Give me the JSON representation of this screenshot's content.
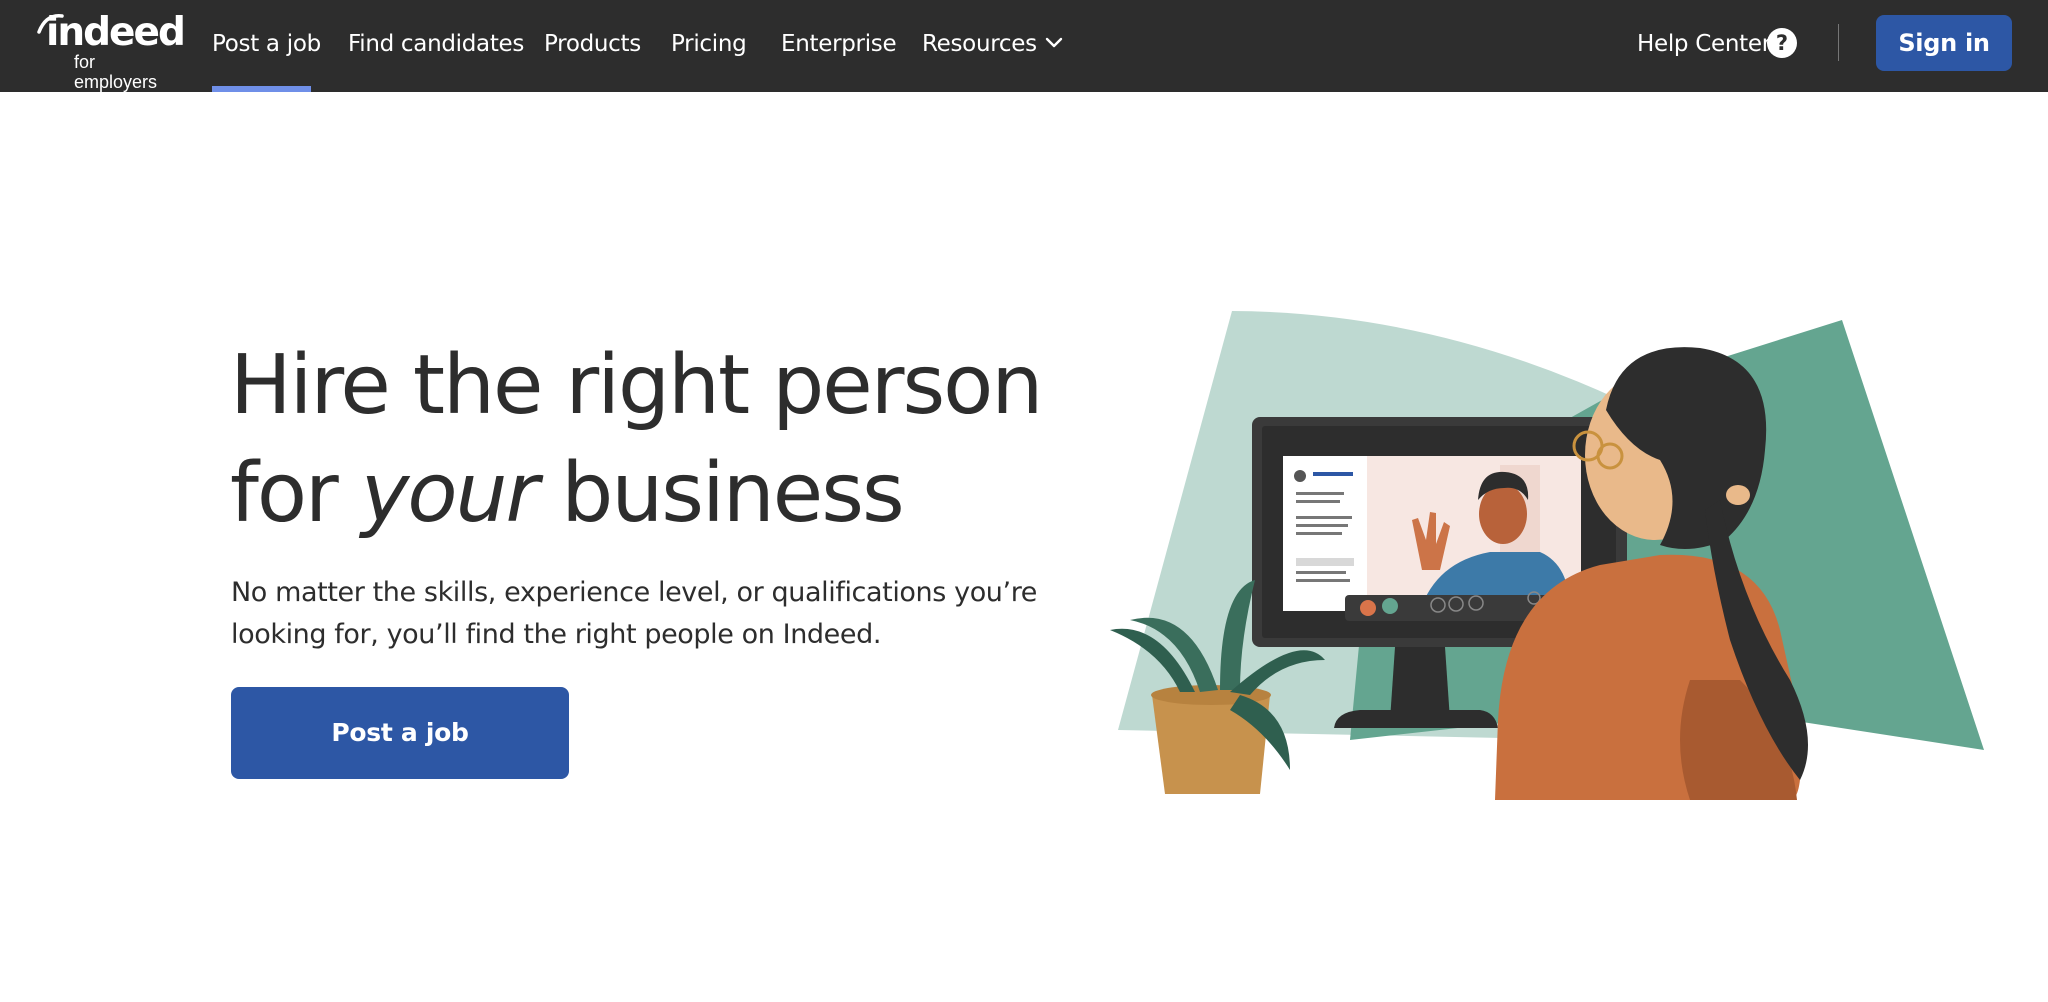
{
  "brand": {
    "wordmark": "indeed",
    "tagline": "for employers"
  },
  "nav": {
    "items": [
      {
        "label": "Post a job",
        "active": true
      },
      {
        "label": "Find candidates"
      },
      {
        "label": "Products"
      },
      {
        "label": "Pricing"
      },
      {
        "label": "Enterprise"
      },
      {
        "label": "Resources",
        "has_dropdown": true
      }
    ],
    "help_label": "Help Center",
    "help_icon_text": "?",
    "signin_label": "Sign in"
  },
  "hero": {
    "headline_line1": "Hire the right person",
    "headline_line2_pre": "for ",
    "headline_line2_em": "your",
    "headline_line2_post": " business",
    "subtext": "No matter the skills, experience level, or qualifications you’re looking for, you’ll find the right people on Indeed.",
    "cta_label": "Post a job"
  },
  "colors": {
    "header_bg": "#2d2d2d",
    "accent_blue": "#2d57a5",
    "active_underline": "#6f8fe8",
    "light_teal": "#bed9d1",
    "teal": "#64a590",
    "skin_orange": "#c9703e"
  },
  "icons": {
    "dropdown": "chevron-down-icon",
    "help": "question-circle-icon"
  }
}
